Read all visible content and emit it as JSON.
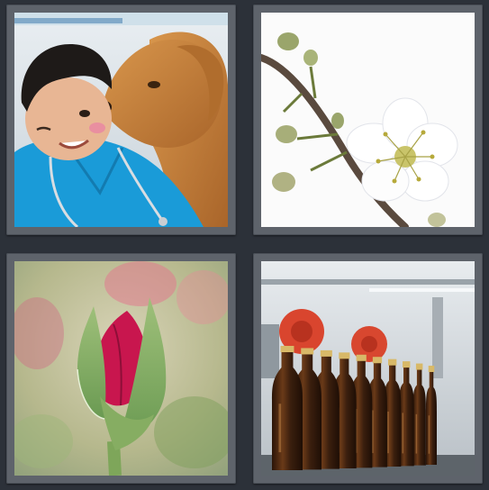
{
  "puzzle": {
    "tiles": [
      {
        "id": "tile-1",
        "subject": "vet-with-dog"
      },
      {
        "id": "tile-2",
        "subject": "blossom-branch"
      },
      {
        "id": "tile-3",
        "subject": "rose-bud"
      },
      {
        "id": "tile-4",
        "subject": "beer-bottles"
      }
    ]
  },
  "colors": {
    "background": "#2c3139",
    "frame": "#5e636b",
    "scrubs": "#1a9bd8",
    "dog_fur": "#c9873e",
    "blossom": "#ffffff",
    "rose": "#c8164e",
    "bottle": "#3b1f0e"
  }
}
